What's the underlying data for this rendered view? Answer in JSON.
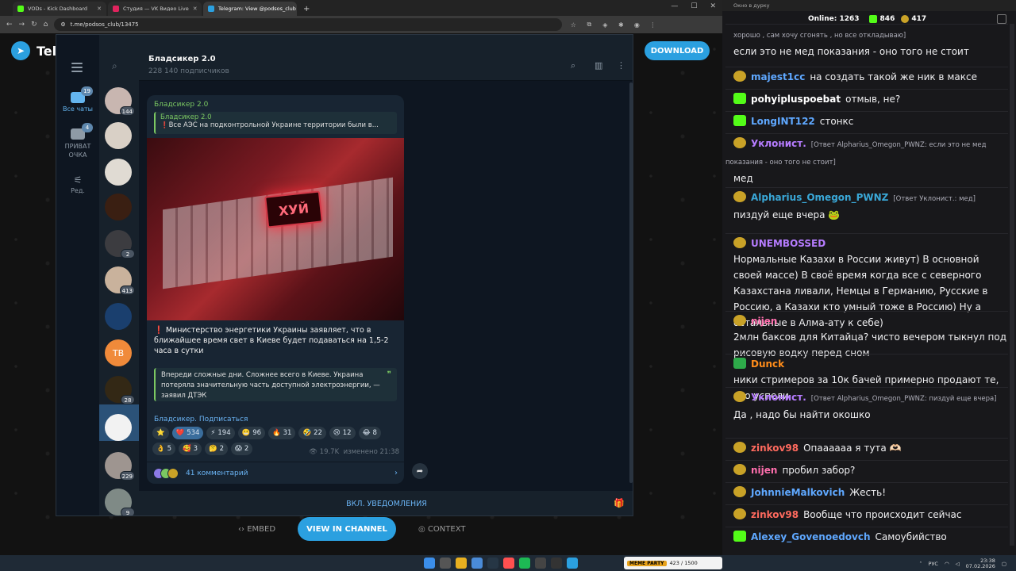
{
  "browser": {
    "tabs": [
      {
        "label": "VODs - Kick Dashboard",
        "color": "#53fc18",
        "active": false
      },
      {
        "label": "Студия — VK Видео Live",
        "color": "#e0245e",
        "active": false
      },
      {
        "label": "Telegram: View @podsos_club",
        "color": "#2ba0e0",
        "active": true
      }
    ],
    "url": "t.me/podsos_club/13475"
  },
  "tme_page": {
    "logo_text": "Teleg",
    "download_label": "DOWNLOAD",
    "embed_label": "EMBED",
    "view_in_channel_label": "VIEW IN CHANNEL",
    "context_label": "CONTEXT"
  },
  "telegram": {
    "folders": [
      {
        "label": "Все чаты",
        "badge": "19",
        "active": true
      },
      {
        "label": "ПРИВАТ ОЧКА",
        "badge": "4",
        "active": false
      },
      {
        "label": "Ред.",
        "badge": "",
        "active": false
      }
    ],
    "chat_avatars": [
      {
        "color": "#c8b6b0",
        "count": "144"
      },
      {
        "color": "#d9d0c6",
        "count": ""
      },
      {
        "color": "#e0dbd3",
        "count": ""
      },
      {
        "color": "#3a1f12",
        "count": ""
      },
      {
        "color": "#3c3c40",
        "count": "2"
      },
      {
        "color": "#c9b29c",
        "count": "413"
      },
      {
        "color": "#1a3f6e",
        "count": ""
      },
      {
        "color": "#f08a3a",
        "count": "",
        "initials": "ТВ"
      },
      {
        "color": "#332815",
        "count": "28"
      },
      {
        "color": "#f2f2f2",
        "count": "",
        "selected": true
      },
      {
        "color": "#9e9590",
        "count": "229"
      },
      {
        "color": "#7f8a86",
        "count": "9"
      }
    ],
    "channel_title": "Бладсикер 2.0",
    "channel_subtitle": "228 140 подписчиков",
    "message": {
      "author": "Бладсикер 2.0",
      "reply_author": "Бладсикер 2.0",
      "reply_text": "❗️Все АЭС на подконтрольной Украине территории были в...",
      "image_sign": "ХУЙ",
      "body": "❗️ Министерство энергетики Украины заявляет, что в ближайшее время свет в Киеве будет подаваться на 1,5-2 часа в сутки",
      "quote": "Впереди сложные дни. Сложнее всего в Киеве. Украина потеряла значительную часть доступной электроэнергии, — заявил ДТЭК",
      "subscribe_link": "Бладсикер. Подписаться",
      "reactions": [
        {
          "emoji": "⭐",
          "count": ""
        },
        {
          "emoji": "❤️",
          "count": "534"
        },
        {
          "emoji": "⚡",
          "count": "194"
        },
        {
          "emoji": "😬",
          "count": "96"
        },
        {
          "emoji": "🔥",
          "count": "31"
        },
        {
          "emoji": "🤣",
          "count": "22"
        },
        {
          "emoji": "😢",
          "count": "12"
        },
        {
          "emoji": "😂",
          "count": "8"
        },
        {
          "emoji": "👌",
          "count": "5"
        },
        {
          "emoji": "🥰",
          "count": "3"
        },
        {
          "emoji": "🤔",
          "count": "2"
        },
        {
          "emoji": "😱",
          "count": "2"
        }
      ],
      "views": "19.7K",
      "edited": "изменено 21:38",
      "comments_label": "41 комментарий"
    },
    "notify_label": "ВКЛ. УВЕДОМЛЕНИЯ"
  },
  "chat_panel": {
    "window_title": "Окно в дурку",
    "online_label": "Online:",
    "online_count": "1263",
    "kick_count": "846",
    "other_count": "417",
    "messages": [
      {
        "icon": "",
        "name": "",
        "name_color": "",
        "reply": "хорошо , сам хочу сгонять , но все откладываю]",
        "text": "если это не мед показания - оно того не стоит"
      },
      {
        "icon": "face",
        "name": "majest1cc",
        "name_color": "#5fa8ff",
        "reply": "",
        "text": "на создать такой же ник в максе"
      },
      {
        "icon": "kick",
        "name": "pohyiplusрoebat",
        "name_color": "#ffffff",
        "reply": "",
        "text": "отмыв, не?"
      },
      {
        "icon": "kick",
        "name": "LongINT122",
        "name_color": "#5fa8ff",
        "reply": "",
        "text": "стонкс"
      },
      {
        "icon": "face",
        "name": "Уклонист.",
        "name_color": "#b67cff",
        "reply": "[Ответ Alpharius_Omegon_PWNZ: если это не мед показания - оно того не стоит]",
        "text": "мед"
      },
      {
        "icon": "face",
        "name": "Alpharius_Omegon_PWNZ",
        "name_color": "#3aa8d8",
        "reply": "[Ответ Уклонист.: мед]",
        "text": "пиздуй еще вчера 🐸"
      },
      {
        "icon": "face",
        "name": "UNEMBOSSED",
        "name_color": "#b67cff",
        "reply": "",
        "text": "Нормальные Казахи в России живут) В основной своей массе) В своё время когда все с северного Казахстана ливали, Немцы в Германию, Русские в Россию, а Казахи кто умный тоже в Россию) Ну а остальные в Алма-ату к себе)"
      },
      {
        "icon": "face",
        "name": "nijen",
        "name_color": "#ff6fae",
        "reply": "",
        "text": "2млн баксов для Китайца? чисто вечером тыкнул под рисовую водку перед сном"
      },
      {
        "icon": "check",
        "name": "Dunck",
        "name_color": "#ff8c1a",
        "reply": "",
        "text": "ники стримеров за 10к бачей примерно продают те, кто успели"
      },
      {
        "icon": "face",
        "name": "Уклонист.",
        "name_color": "#b67cff",
        "reply": "[Ответ Alpharius_Omegon_PWNZ: пиздуй еще вчера]",
        "text": "Да , надо бы найти окошко"
      },
      {
        "icon": "face",
        "name": "zinkov98",
        "name_color": "#ff6a5e",
        "reply": "",
        "text": "Опаааааа я тута 🫶🏻"
      },
      {
        "icon": "face",
        "name": "nijen",
        "name_color": "#ff6fae",
        "reply": "",
        "text": "пробил забор?"
      },
      {
        "icon": "face",
        "name": "JohnnieMalkovich",
        "name_color": "#5fa8ff",
        "reply": "",
        "text": "Жесть!"
      },
      {
        "icon": "face",
        "name": "zinkov98",
        "name_color": "#ff6a5e",
        "reply": "",
        "text": "Вообще что происходит сейчас"
      },
      {
        "icon": "kick",
        "name": "Alexey_Govenoedovch",
        "name_color": "#5fa8ff",
        "reply": "",
        "text": "Самоубийство"
      }
    ]
  },
  "taskbar": {
    "media_badge": "MEME PARTY",
    "media_text": "423 / 1500",
    "lang": "РУС",
    "time": "23:38",
    "date": "07.02.2026"
  }
}
